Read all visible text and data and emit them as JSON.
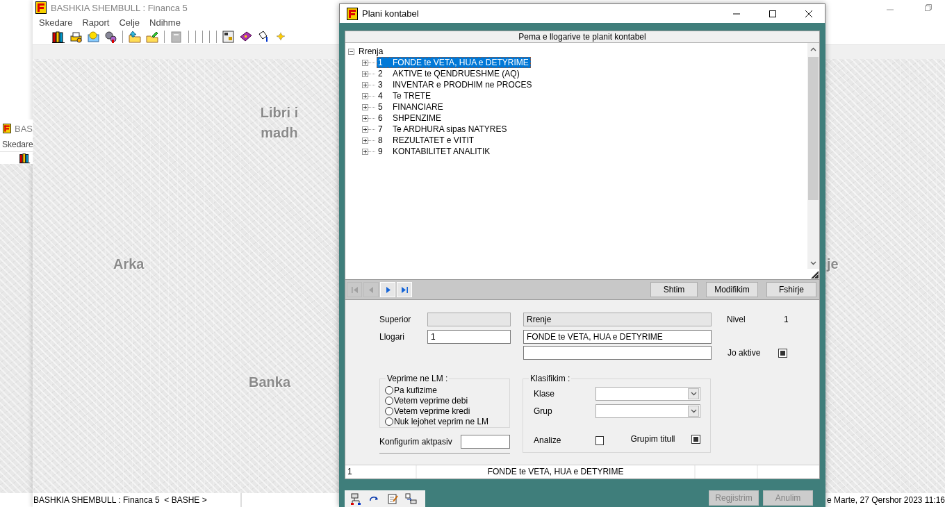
{
  "app": {
    "title": "BASHKIA SHEMBULL : Financa 5",
    "menu": [
      "Skedare",
      "Raport",
      "Celje",
      "Ndihme"
    ],
    "desktop_labels": [
      "Libri i madh",
      "Arka",
      "Banka",
      "je"
    ],
    "status_bar": {
      "left": "BASHKIA SHEMBULL : Financa 5  < BASHE >",
      "right": "e Marte, 27 Qershor 2023 11:16"
    }
  },
  "second_window": {
    "title": "BAS",
    "menu": [
      "Skedare"
    ]
  },
  "dialog": {
    "title": "Plani kontabel",
    "tree": {
      "header": "Pema e llogarive te planit kontabel",
      "root": {
        "label": "Rrenja",
        "expanded": true,
        "children": [
          {
            "code": "1",
            "label": "FONDE te VETA, HUA e DETYRIME",
            "expanded": false,
            "selected": true
          },
          {
            "code": "2",
            "label": "AKTIVE te QENDRUESHME (AQ)",
            "expanded": false,
            "selected": false
          },
          {
            "code": "3",
            "label": "INVENTAR e PRODHIM ne PROCES",
            "expanded": false,
            "selected": false
          },
          {
            "code": "4",
            "label": "Te TRETE",
            "expanded": false,
            "selected": false
          },
          {
            "code": "5",
            "label": "FINANCIARE",
            "expanded": false,
            "selected": false
          },
          {
            "code": "6",
            "label": "SHPENZIME",
            "expanded": false,
            "selected": false
          },
          {
            "code": "7",
            "label": "Te ARDHURA sipas NATYRES",
            "expanded": false,
            "selected": false
          },
          {
            "code": "8",
            "label": "REZULTATET e VITIT",
            "expanded": false,
            "selected": false
          },
          {
            "code": "9",
            "label": "KONTABILITET ANALITIK",
            "expanded": false,
            "selected": false
          }
        ]
      }
    },
    "nav_buttons": [
      {
        "kind": "first",
        "disabled": true
      },
      {
        "kind": "previous",
        "disabled": true
      },
      {
        "kind": "next",
        "disabled": false
      },
      {
        "kind": "last",
        "disabled": false
      }
    ],
    "action_buttons": [
      "Shtim",
      "Modifikim",
      "Fshirje"
    ],
    "form": {
      "superior": {
        "label": "Superior",
        "name": "Rrenje"
      },
      "llogari": {
        "label": "Llogari",
        "code": "1",
        "name": "FONDE te VETA, HUA e DETYRIME"
      },
      "nivel": {
        "label": "Nivel",
        "value": "1"
      },
      "jo_aktive": {
        "label": "Jo aktive",
        "checked": true
      },
      "veprime": {
        "title": "Veprime ne LM :",
        "options": [
          {
            "label": "Pa kufizime",
            "selected": false
          },
          {
            "label": "Vetem veprime debi",
            "selected": false
          },
          {
            "label": "Vetem veprime kredi",
            "selected": false
          },
          {
            "label": "Nuk lejohet veprim ne LM",
            "selected": false
          }
        ]
      },
      "konfigurim": {
        "label": "Konfigurim aktpasiv"
      },
      "klasifikim": {
        "title": "Klasifikim :",
        "klase": {
          "label": "Klase"
        },
        "grup": {
          "label": "Grup"
        },
        "analize": {
          "label": "Analize",
          "checked": false
        },
        "grupim_titull": {
          "label": "Grupim titull",
          "checked": true
        }
      }
    },
    "status_row": [
      "1",
      "FONDE te VETA, HUA e DETYRIME"
    ],
    "footer_buttons": [
      {
        "label": "Regjistrim",
        "disabled": true
      },
      {
        "label": "Anulim",
        "disabled": true
      }
    ]
  }
}
